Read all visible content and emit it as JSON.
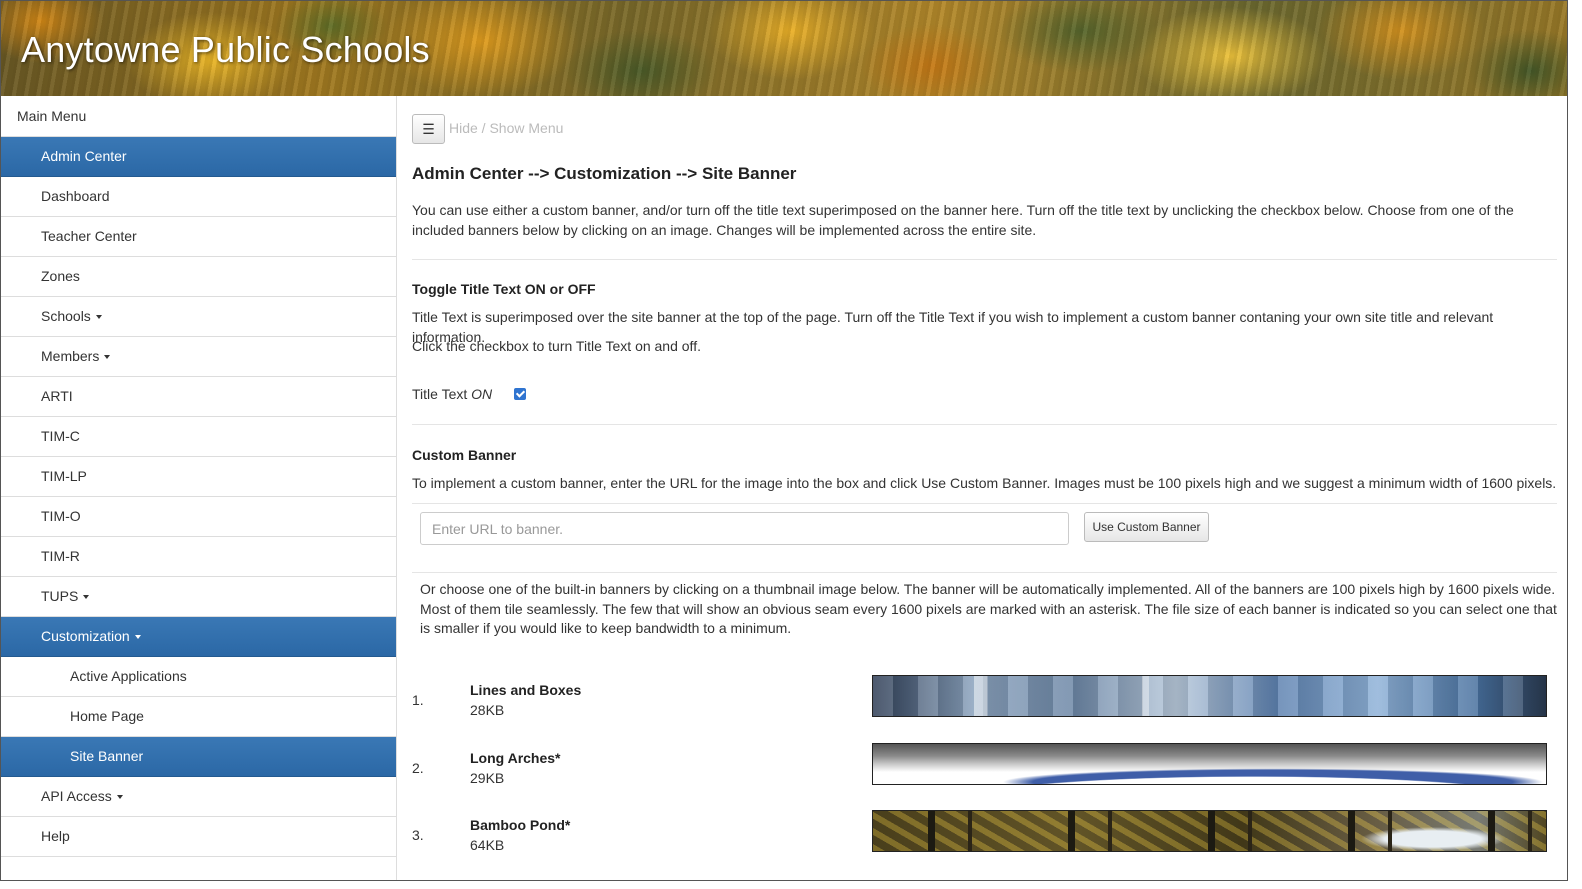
{
  "header": {
    "site_title": "Anytowne Public Schools"
  },
  "sidebar": {
    "heading": "Main Menu",
    "items": [
      {
        "label": "Admin Center",
        "active": true
      },
      {
        "label": "Dashboard"
      },
      {
        "label": "Teacher Center"
      },
      {
        "label": "Zones"
      },
      {
        "label": "Schools",
        "dropdown": true
      },
      {
        "label": "Members",
        "dropdown": true
      },
      {
        "label": "ARTI"
      },
      {
        "label": "TIM-C"
      },
      {
        "label": "TIM-LP"
      },
      {
        "label": "TIM-O"
      },
      {
        "label": "TIM-R"
      },
      {
        "label": "TUPS",
        "dropdown": true
      },
      {
        "label": "Customization",
        "dropdown": true,
        "active": true
      },
      {
        "label": "Active Applications",
        "sub": true
      },
      {
        "label": "Home Page",
        "sub": true
      },
      {
        "label": "Site Banner",
        "sub": true,
        "active": true
      },
      {
        "label": "API Access",
        "dropdown": true
      },
      {
        "label": "Help"
      }
    ],
    "active_color": "#2f6eab"
  },
  "toolbar": {
    "menu_icon": "hamburger-icon",
    "toggle_label": "Hide / Show Menu"
  },
  "main": {
    "page_title": "Admin Center --> Customization --> Site Banner",
    "intro": "You can use either a custom banner, and/or turn off the title text superimposed on the banner here. Turn off the title text by unclicking the checkbox below. Choose from one of the included banners below by clicking on an image. Changes will be implemented across the entire site.",
    "toggle_section": {
      "heading": "Toggle Title Text ON or OFF",
      "description": "Title Text is superimposed over the site banner at the top of the page. Turn off the Title Text if you wish to implement a custom banner contaning your own site title and relevant information.",
      "instruction": "Click the checkbox to turn Title Text on and off.",
      "checkbox_label": "Title Text",
      "checkbox_state": "ON",
      "checked": true
    },
    "custom_banner": {
      "heading": "Custom Banner",
      "description": "To implement a custom banner, enter the URL for the image into the box and click Use Custom Banner. Images must be 100 pixels high and we suggest a minimum width of 1600 pixels.",
      "input_value": "",
      "input_placeholder": "Enter URL to banner.",
      "button_label": "Use Custom Banner"
    },
    "builtin_intro": "Or choose one of the built-in banners by clicking on a thumbnail image below. The banner will be automatically implemented. All of the banners are 100 pixels high by 1600 pixels wide. Most of them tile seamlessly. The few that will show an obvious seam every 1600 pixels are marked with an asterisk. The file size of each banner is indicated so you can select one that is smaller if you would like to keep bandwidth to a minimum.",
    "banners": [
      {
        "number": "1.",
        "name": "Lines and Boxes",
        "size": "28KB"
      },
      {
        "number": "2.",
        "name": "Long Arches*",
        "size": "29KB"
      },
      {
        "number": "3.",
        "name": "Bamboo Pond*",
        "size": "64KB"
      }
    ]
  }
}
